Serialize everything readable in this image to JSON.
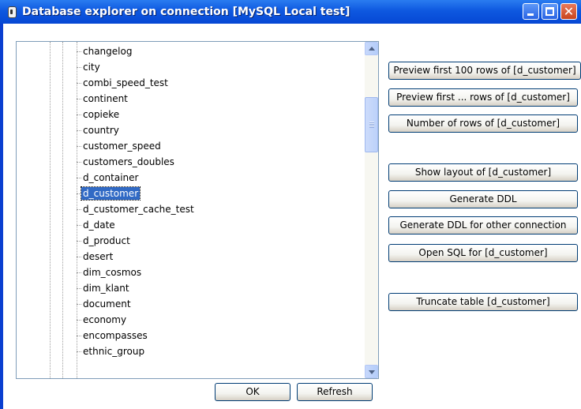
{
  "window": {
    "title": "Database explorer on connection [MySQL Local test]",
    "title_icon": "lock-icon"
  },
  "title_buttons": {
    "minimize": "minimize-icon",
    "maximize": "maximize-icon",
    "close_glyph": "✕"
  },
  "tree": {
    "items": [
      "changelog",
      "city",
      "combi_speed_test",
      "continent",
      "copieke",
      "country",
      "customer_speed",
      "customers_doubles",
      "d_container",
      "d_customer",
      "d_customer_cache_test",
      "d_date",
      "d_product",
      "desert",
      "dim_cosmos",
      "dim_klant",
      "document",
      "economy",
      "encompasses",
      "ethnic_group"
    ],
    "selected": "d_customer"
  },
  "actions": {
    "preview_100": "Preview first 100 rows of [d_customer]",
    "preview_n": "Preview first ... rows of [d_customer]",
    "row_count": "Number of rows of [d_customer]",
    "show_layout": "Show layout of [d_customer]",
    "generate_ddl": "Generate DDL",
    "generate_ddl_other": "Generate DDL for other connection",
    "open_sql": "Open SQL for [d_customer]",
    "truncate": "Truncate table [d_customer]"
  },
  "footer": {
    "ok": "OK",
    "refresh": "Refresh"
  },
  "colors": {
    "titlebar": "#0a58e0",
    "selection": "#316ac5",
    "border": "#7f9db9"
  }
}
